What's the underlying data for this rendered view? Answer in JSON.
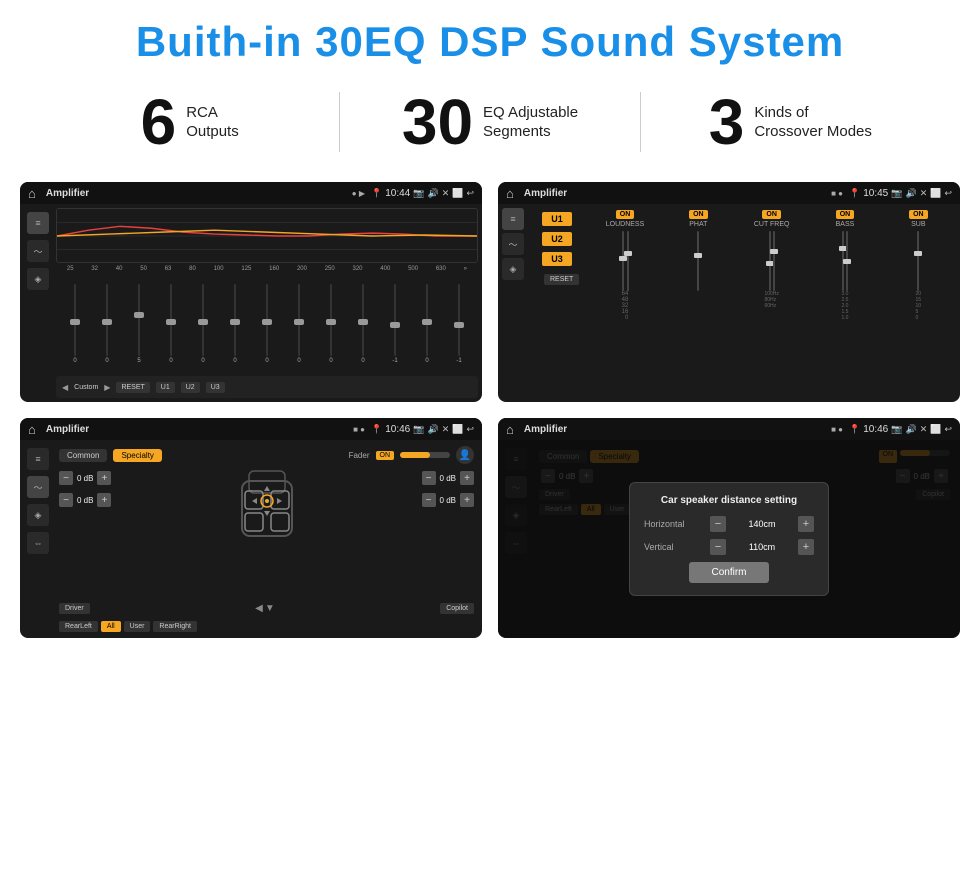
{
  "header": {
    "title": "Buith-in 30EQ DSP Sound System"
  },
  "stats": [
    {
      "number": "6",
      "text_line1": "RCA",
      "text_line2": "Outputs"
    },
    {
      "number": "30",
      "text_line1": "EQ Adjustable",
      "text_line2": "Segments"
    },
    {
      "number": "3",
      "text_line1": "Kinds of",
      "text_line2": "Crossover Modes"
    }
  ],
  "screens": {
    "top_left": {
      "app_label": "Amplifier",
      "time": "10:44",
      "eq_freqs": [
        "25",
        "32",
        "40",
        "50",
        "63",
        "80",
        "100",
        "125",
        "160",
        "200",
        "250",
        "320",
        "400",
        "500",
        "630"
      ],
      "eq_values": [
        "0",
        "0",
        "0",
        "5",
        "0",
        "0",
        "0",
        "0",
        "0",
        "0",
        "0",
        "0",
        "-1",
        "0",
        "-1"
      ],
      "preset_label": "Custom",
      "buttons": [
        "RESET",
        "U1",
        "U2",
        "U3"
      ]
    },
    "top_right": {
      "app_label": "Amplifier",
      "time": "10:45",
      "u_buttons": [
        "U1",
        "U2",
        "U3"
      ],
      "channels": [
        "LOUDNESS",
        "PHAT",
        "CUT FREQ",
        "BASS",
        "SUB"
      ],
      "on_labels": [
        "ON",
        "ON",
        "ON",
        "ON",
        "ON"
      ],
      "reset_label": "RESET"
    },
    "bottom_left": {
      "app_label": "Amplifier",
      "time": "10:46",
      "tabs": [
        "Common",
        "Specialty"
      ],
      "fader_label": "Fader",
      "fader_on": "ON",
      "db_values": [
        "0 dB",
        "0 dB",
        "0 dB",
        "0 dB"
      ],
      "buttons": [
        "Driver",
        "Copilot",
        "RearLeft",
        "All",
        "User",
        "RearRight"
      ]
    },
    "bottom_right": {
      "app_label": "Amplifier",
      "time": "10:46",
      "tabs": [
        "Common",
        "Specialty"
      ],
      "dialog": {
        "title": "Car speaker distance setting",
        "horizontal_label": "Horizontal",
        "horizontal_value": "140cm",
        "vertical_label": "Vertical",
        "vertical_value": "110cm",
        "confirm_label": "Confirm"
      },
      "db_values": [
        "0 dB",
        "0 dB"
      ],
      "buttons": [
        "Driver",
        "Copilot",
        "RearLeft",
        "All",
        "User",
        "RearRight"
      ]
    }
  },
  "icons": {
    "home": "⌂",
    "back": "↩",
    "pin": "📍",
    "camera": "📷",
    "volume": "🔊",
    "close": "✕",
    "window": "⬜",
    "eq_icon": "≡",
    "wave_icon": "〜",
    "speaker_icon": "◈",
    "settings_icon": "⚙",
    "person": "👤"
  }
}
